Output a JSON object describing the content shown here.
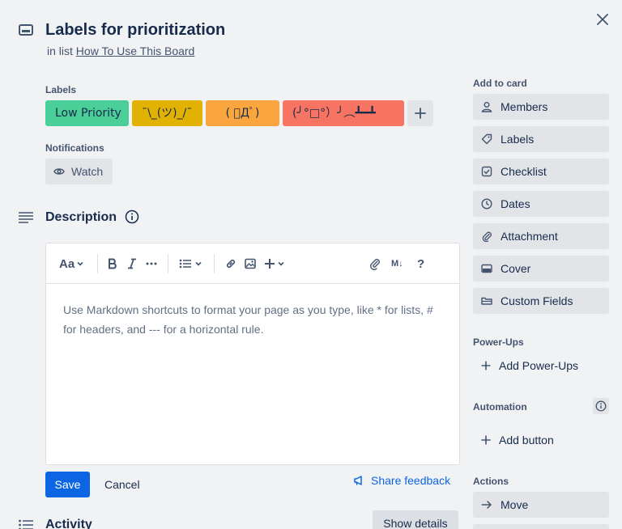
{
  "card": {
    "title": "Labels for prioritization",
    "in_list_prefix": "in list",
    "list_name": "How To Use This Board"
  },
  "labels_section": {
    "heading": "Labels",
    "items": [
      {
        "text": "Low Priority",
        "color": "#4bce97"
      },
      {
        "text": "¯\\_(ツ)_/¯",
        "color": "#e2b203"
      },
      {
        "text": "( ﾟДﾟ)",
        "color": "#faa53d"
      },
      {
        "text": "(╯°□°）╯︵┻━┻",
        "color": "#f87462"
      }
    ]
  },
  "notifications": {
    "heading": "Notifications",
    "watch_label": "Watch"
  },
  "description": {
    "heading": "Description",
    "placeholder": "Use Markdown shortcuts to format your page as you type, like * for lists, # for headers, and --- for a horizontal rule.",
    "toolbar": {
      "text_style": "Aa",
      "markdown_badge": "M↓",
      "help": "?"
    },
    "save_label": "Save",
    "cancel_label": "Cancel",
    "feedback_label": "Share feedback"
  },
  "activity": {
    "heading": "Activity",
    "show_details_label": "Show details"
  },
  "sidebar": {
    "add_to_card_heading": "Add to card",
    "add_to_card": [
      {
        "label": "Members",
        "icon": "person-icon"
      },
      {
        "label": "Labels",
        "icon": "tag-icon"
      },
      {
        "label": "Checklist",
        "icon": "checkbox-icon"
      },
      {
        "label": "Dates",
        "icon": "clock-icon"
      },
      {
        "label": "Attachment",
        "icon": "paperclip-icon"
      },
      {
        "label": "Cover",
        "icon": "card-cover-icon"
      },
      {
        "label": "Custom Fields",
        "icon": "custom-fields-icon"
      }
    ],
    "power_ups_heading": "Power-Ups",
    "add_power_ups_label": "Add Power-Ups",
    "automation_heading": "Automation",
    "add_button_label": "Add button",
    "actions_heading": "Actions",
    "move_label": "Move"
  },
  "colors": {
    "background": "#f1f2f4",
    "primary": "#0c66e4",
    "button_bg": "#e2e4e8",
    "text": "#172b4d",
    "subtle_text": "#44546f"
  }
}
